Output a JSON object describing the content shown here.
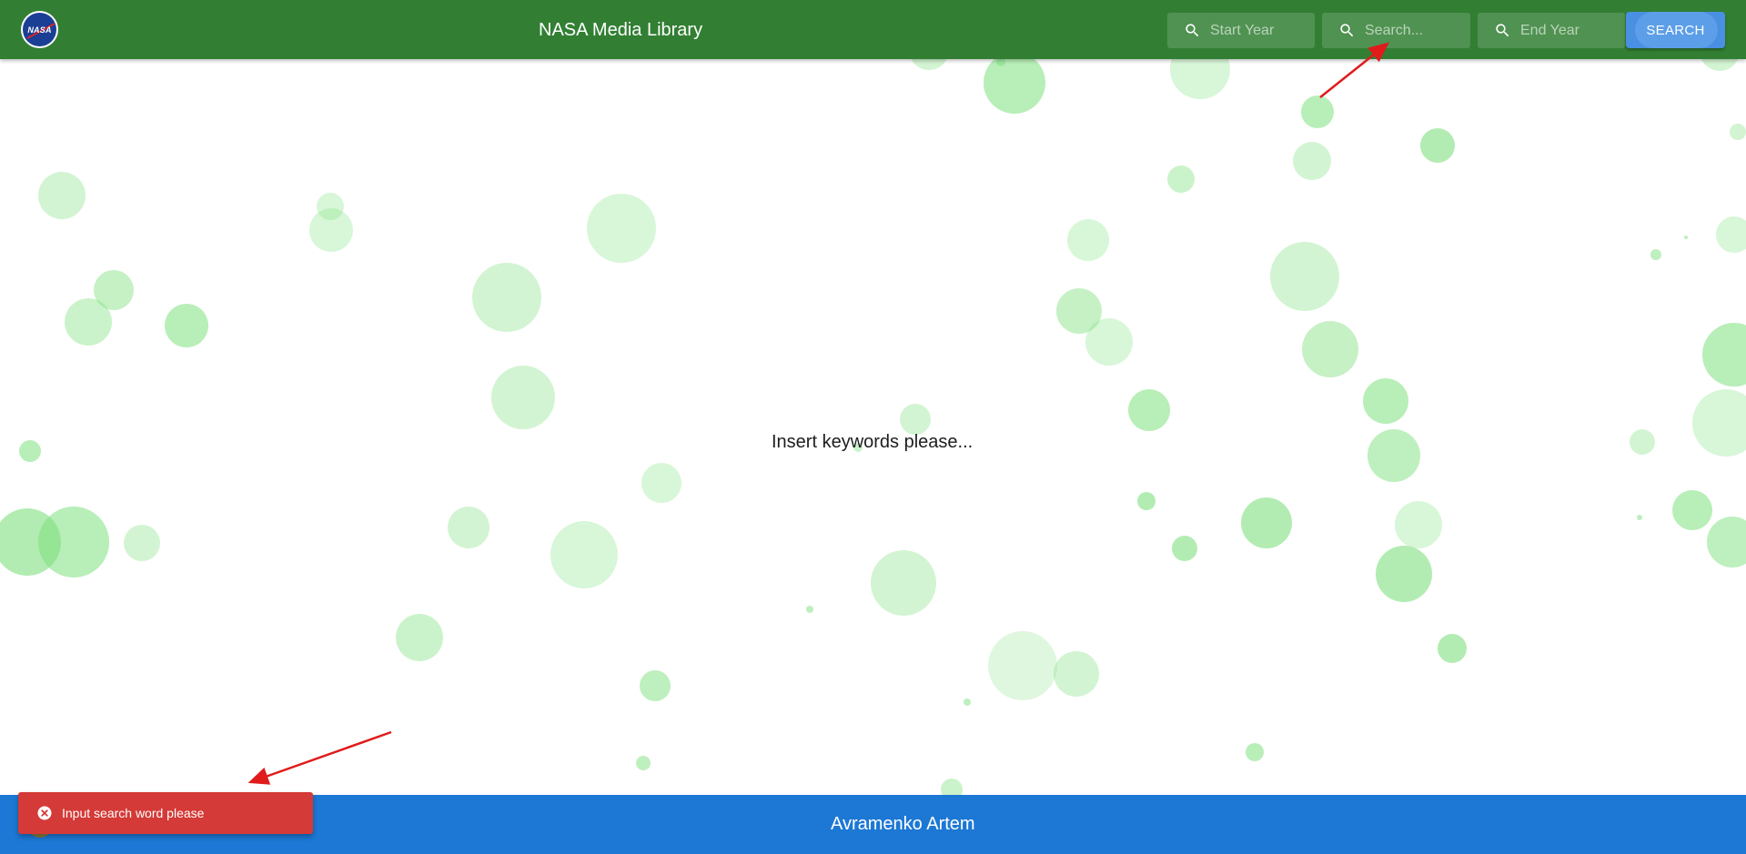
{
  "header": {
    "logo_text": "NASA",
    "title": "NASA Media Library",
    "start_year_placeholder": "Start Year",
    "search_placeholder": "Search...",
    "end_year_placeholder": "End Year",
    "search_button": "SEARCH",
    "icon": "search-icon"
  },
  "main": {
    "message": "Insert keywords please..."
  },
  "footer": {
    "author": "Avramenko Artem"
  },
  "toast": {
    "message": "Input search word please",
    "icon": "error-circle-icon"
  },
  "colors": {
    "header_bg": "#327f34",
    "footer_bg": "#1c78d4",
    "toast_bg": "#d43a37",
    "bubble": "#7ee07e",
    "annotation_arrow": "#e01b1b"
  }
}
